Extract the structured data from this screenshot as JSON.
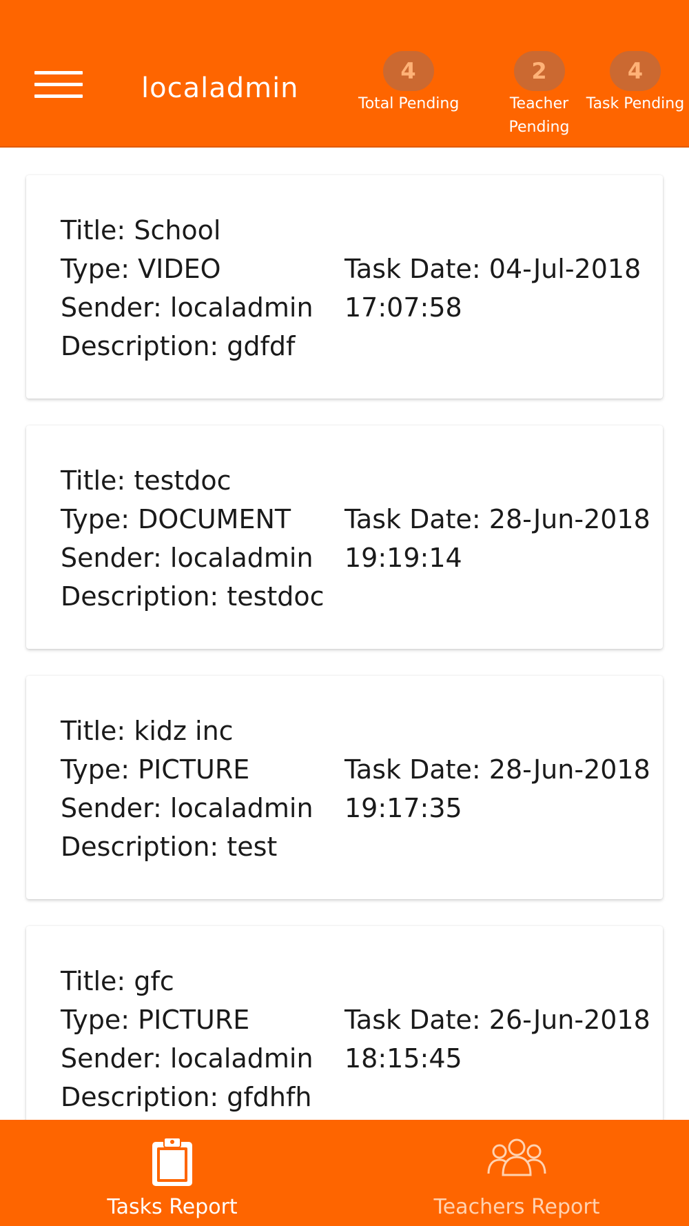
{
  "header": {
    "title": "localadmin",
    "stats": [
      {
        "count": "4",
        "label": "Total Pending"
      },
      {
        "count": "2",
        "label": "Teacher Pending"
      },
      {
        "count": "4",
        "label": "Task Pending"
      }
    ]
  },
  "tasks": [
    {
      "title": "Title: School",
      "type": "Type: VIDEO",
      "sender": "Sender: localadmin",
      "description": "Description: gdfdf",
      "date": "Task Date: 04-Jul-2018",
      "time": "17:07:58"
    },
    {
      "title": "Title: testdoc",
      "type": "Type: DOCUMENT",
      "sender": "Sender: localadmin",
      "description": "Description: testdoc",
      "date": "Task Date: 28-Jun-2018",
      "time": "19:19:14"
    },
    {
      "title": "Title: kidz inc",
      "type": "Type: PICTURE",
      "sender": "Sender: localadmin",
      "description": "Description: test",
      "date": "Task Date: 28-Jun-2018",
      "time": "19:17:35"
    },
    {
      "title": "Title: gfc",
      "type": "Type: PICTURE",
      "sender": "Sender: localadmin",
      "description": "Description: gfdhfh",
      "date": "Task Date: 26-Jun-2018",
      "time": "18:15:45"
    }
  ],
  "bottom_nav": {
    "tasks_label": "Tasks Report",
    "tasks_icon": "clipboard-icon",
    "teachers_label": "Teachers Report",
    "teachers_icon": "group-icon"
  },
  "colors": {
    "primary": "#fe6500",
    "badge_text": "#ffb277"
  }
}
